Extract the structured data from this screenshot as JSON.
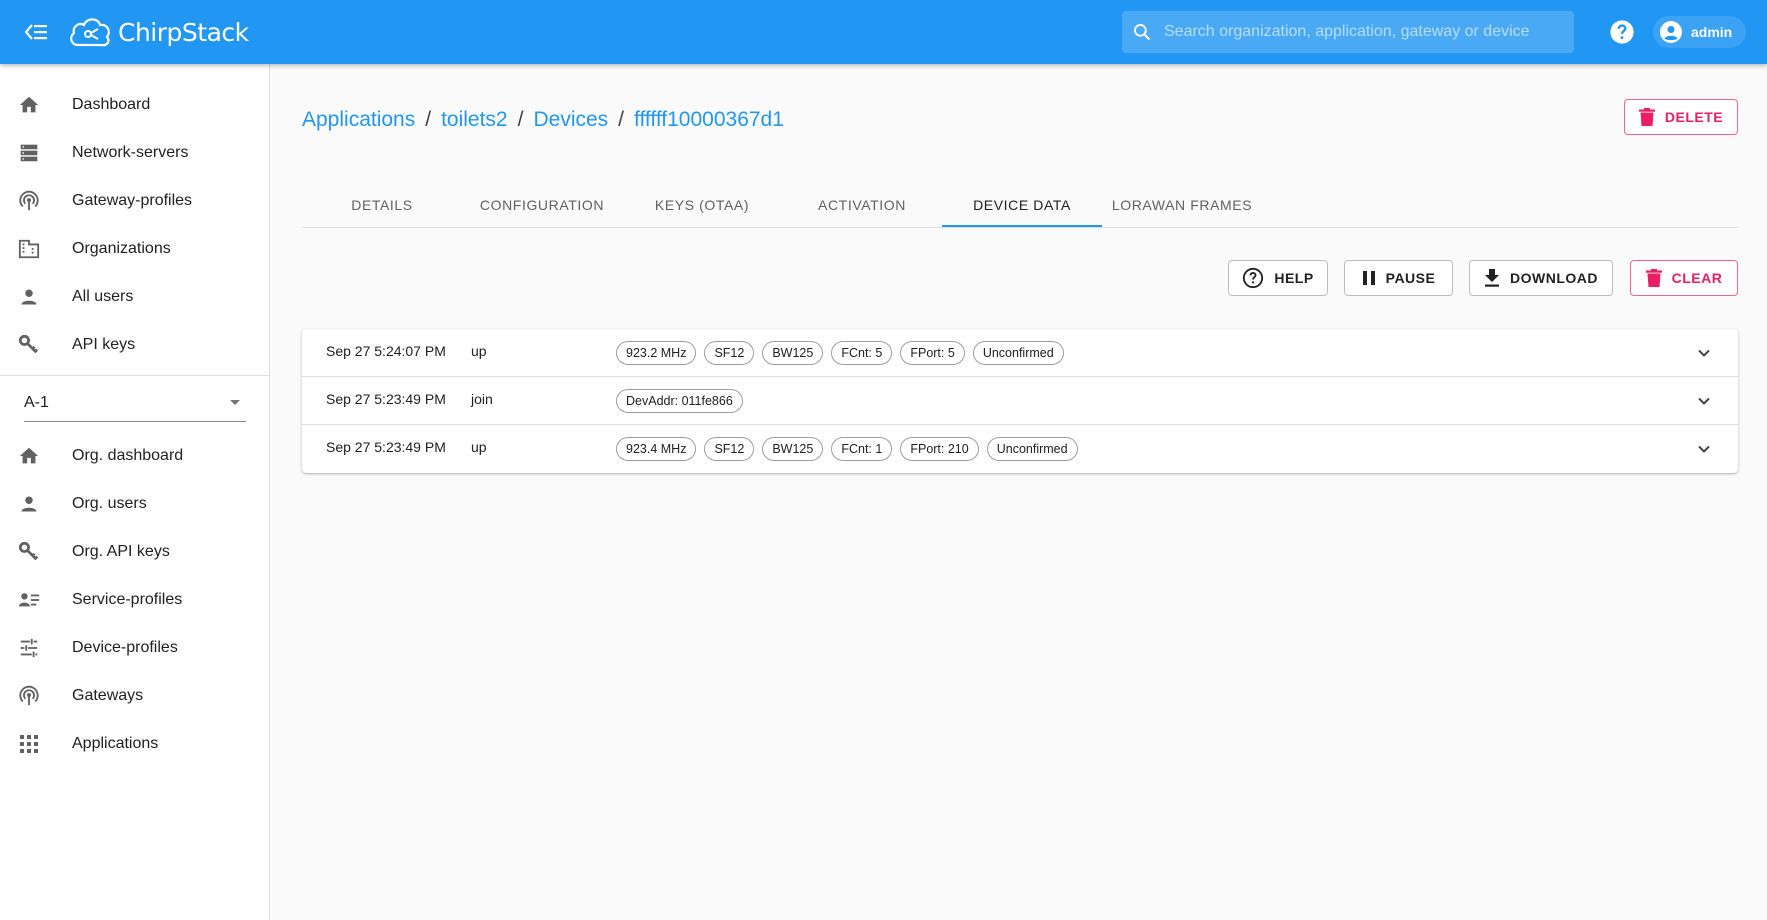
{
  "header": {
    "logo_text": "ChirpStack",
    "search_placeholder": "Search organization, application, gateway or device",
    "user_label": "admin"
  },
  "sidebar": {
    "global_items": [
      {
        "label": "Dashboard",
        "icon": "home-icon"
      },
      {
        "label": "Network-servers",
        "icon": "server-icon"
      },
      {
        "label": "Gateway-profiles",
        "icon": "antenna-icon"
      },
      {
        "label": "Organizations",
        "icon": "building-icon"
      },
      {
        "label": "All users",
        "icon": "person-icon"
      },
      {
        "label": "API keys",
        "icon": "key-icon"
      }
    ],
    "org_selector": "A-1",
    "org_items": [
      {
        "label": "Org. dashboard",
        "icon": "home-icon"
      },
      {
        "label": "Org. users",
        "icon": "person-icon"
      },
      {
        "label": "Org. API keys",
        "icon": "key-icon"
      },
      {
        "label": "Service-profiles",
        "icon": "account-details-icon"
      },
      {
        "label": "Device-profiles",
        "icon": "tune-icon"
      },
      {
        "label": "Gateways",
        "icon": "antenna-icon"
      },
      {
        "label": "Applications",
        "icon": "apps-grid-icon"
      }
    ]
  },
  "breadcrumb": {
    "applications": "Applications",
    "application": "toilets2",
    "devices": "Devices",
    "device": "ffffff10000367d1",
    "separator": "/"
  },
  "actions": {
    "delete": "DELETE",
    "help": "HELP",
    "pause": "PAUSE",
    "download": "DOWNLOAD",
    "clear": "CLEAR"
  },
  "tabs": [
    {
      "label": "DETAILS"
    },
    {
      "label": "CONFIGURATION"
    },
    {
      "label": "KEYS (OTAA)"
    },
    {
      "label": "ACTIVATION"
    },
    {
      "label": "DEVICE DATA",
      "active": true
    },
    {
      "label": "LORAWAN FRAMES"
    }
  ],
  "frames": [
    {
      "time": "Sep 27 5:24:07 PM",
      "type": "up",
      "chips": [
        "923.2 MHz",
        "SF12",
        "BW125",
        "FCnt: 5",
        "FPort: 5",
        "Unconfirmed"
      ]
    },
    {
      "time": "Sep 27 5:23:49 PM",
      "type": "join",
      "chips": [
        "DevAddr: 011fe866"
      ]
    },
    {
      "time": "Sep 27 5:23:49 PM",
      "type": "up",
      "chips": [
        "923.4 MHz",
        "SF12",
        "BW125",
        "FCnt: 1",
        "FPort: 210",
        "Unconfirmed"
      ]
    }
  ],
  "colors": {
    "primary": "#2196f3",
    "danger": "#e91e63"
  }
}
